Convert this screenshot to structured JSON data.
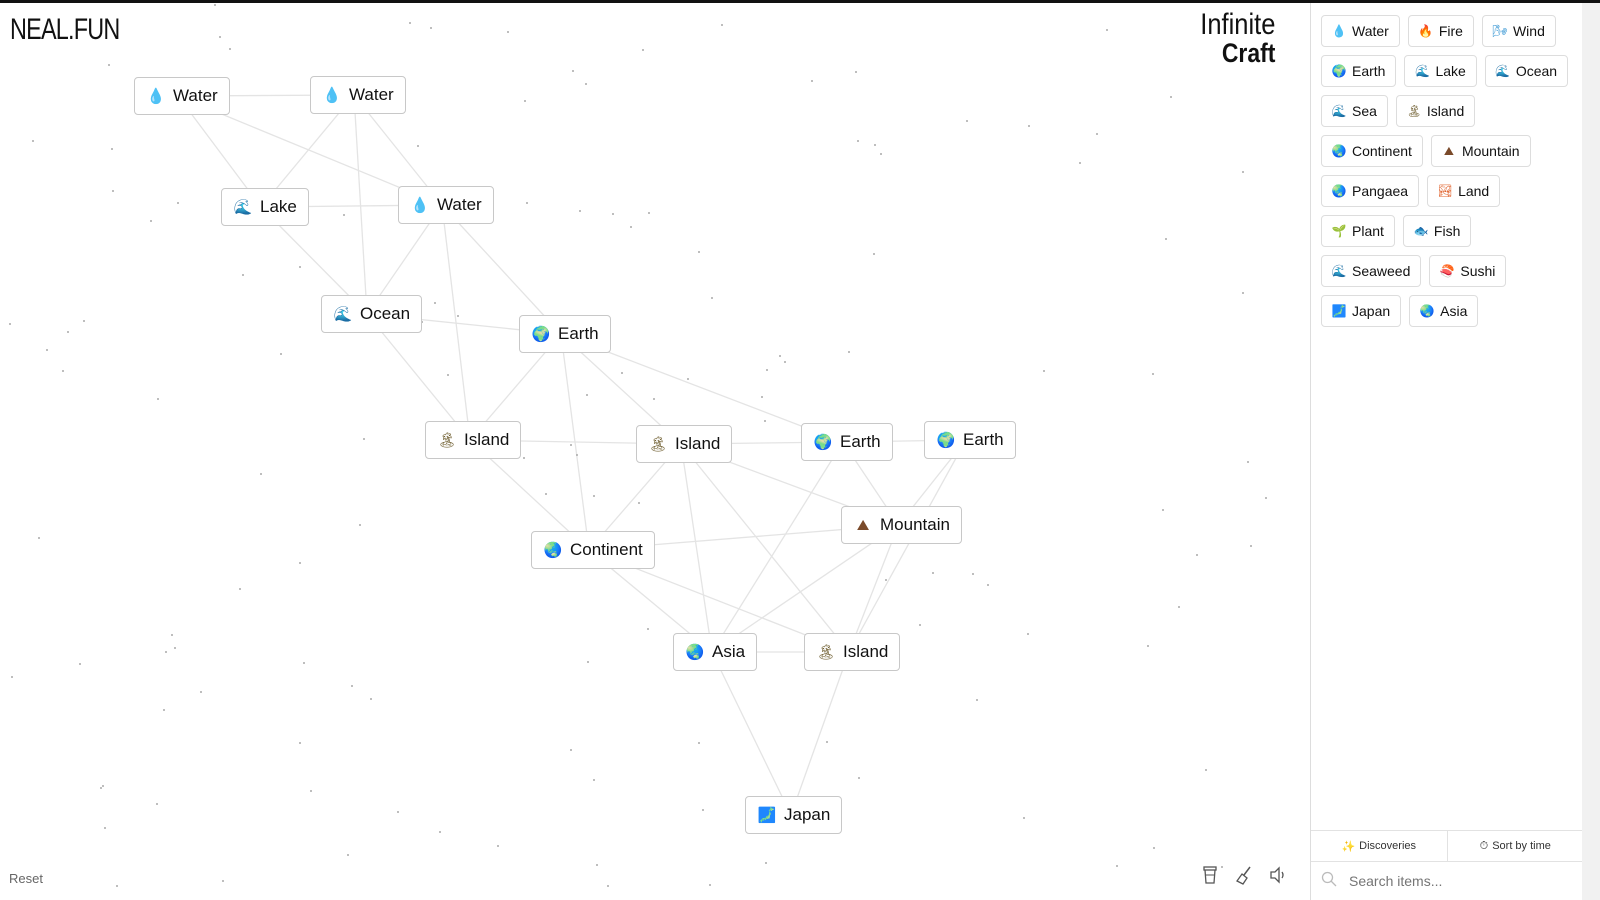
{
  "brand": {
    "logo": "NEAL.FUN",
    "title_line1": "Infinite",
    "title_line2": "Craft"
  },
  "canvas": {
    "nodes": [
      {
        "id": "n1",
        "label": "Water",
        "icon": "water-drop-icon",
        "glyph": "💧",
        "color": "#2aa7e0"
      },
      {
        "id": "n2",
        "label": "Water",
        "icon": "water-drop-icon",
        "glyph": "💧",
        "color": "#2aa7e0"
      },
      {
        "id": "n3",
        "label": "Lake",
        "icon": "wave-icon",
        "glyph": "🌊",
        "color": "#1e9ad6"
      },
      {
        "id": "n4",
        "label": "Water",
        "icon": "water-drop-icon",
        "glyph": "💧",
        "color": "#2aa7e0"
      },
      {
        "id": "n5",
        "label": "Ocean",
        "icon": "wave-icon",
        "glyph": "🌊",
        "color": "#1e9ad6"
      },
      {
        "id": "n6",
        "label": "Earth",
        "icon": "globe-icon",
        "glyph": "🌍",
        "color": "#1f8f6a"
      },
      {
        "id": "n7",
        "label": "Island",
        "icon": "palm-island-icon",
        "glyph": "🏝",
        "color": "#6b5a2a"
      },
      {
        "id": "n8",
        "label": "Island",
        "icon": "palm-island-icon",
        "glyph": "🏝",
        "color": "#6b5a2a"
      },
      {
        "id": "n9",
        "label": "Earth",
        "icon": "globe-icon",
        "glyph": "🌍",
        "color": "#1f8f6a"
      },
      {
        "id": "n10",
        "label": "Earth",
        "icon": "globe-icon",
        "glyph": "🌍",
        "color": "#1f8f6a"
      },
      {
        "id": "n11",
        "label": "Mountain",
        "icon": "mountain-icon",
        "glyph": "⛰",
        "color": "#7a4a2a"
      },
      {
        "id": "n12",
        "label": "Continent",
        "icon": "globe-icon",
        "glyph": "🌏",
        "color": "#1f7fa0"
      },
      {
        "id": "n13",
        "label": "Asia",
        "icon": "globe-icon",
        "glyph": "🌏",
        "color": "#1f7fa0"
      },
      {
        "id": "n14",
        "label": "Island",
        "icon": "palm-island-icon",
        "glyph": "🏝",
        "color": "#6b5a2a"
      },
      {
        "id": "n15",
        "label": "Japan",
        "icon": "japan-map-icon",
        "glyph": "🗾",
        "color": "#2aa060"
      }
    ],
    "reset_label": "Reset"
  },
  "toolbar": {
    "icons": [
      "cup-icon",
      "broom-icon",
      "speaker-icon"
    ]
  },
  "sidebar": {
    "items": [
      {
        "label": "Water",
        "icon": "water-drop-icon",
        "glyph": "💧",
        "color": "#2aa7e0"
      },
      {
        "label": "Fire",
        "icon": "fire-icon",
        "glyph": "🔥",
        "color": "#f08a24"
      },
      {
        "label": "Wind",
        "icon": "wind-icon",
        "glyph": "🌬",
        "color": "#2a8fd0"
      },
      {
        "label": "Earth",
        "icon": "globe-icon",
        "glyph": "🌍",
        "color": "#1f8f6a"
      },
      {
        "label": "Lake",
        "icon": "wave-icon",
        "glyph": "🌊",
        "color": "#1e9ad6"
      },
      {
        "label": "Ocean",
        "icon": "wave-icon",
        "glyph": "🌊",
        "color": "#1e9ad6"
      },
      {
        "label": "Sea",
        "icon": "wave-icon",
        "glyph": "🌊",
        "color": "#1e9ad6"
      },
      {
        "label": "Island",
        "icon": "palm-island-icon",
        "glyph": "🏝",
        "color": "#6b5a2a"
      },
      {
        "label": "Continent",
        "icon": "globe-icon",
        "glyph": "🌏",
        "color": "#1f7fa0"
      },
      {
        "label": "Mountain",
        "icon": "mountain-icon",
        "glyph": "⛰",
        "color": "#7a4a2a"
      },
      {
        "label": "Pangaea",
        "icon": "globe-icon",
        "glyph": "🌏",
        "color": "#1f7fa0"
      },
      {
        "label": "Land",
        "icon": "landscape-icon",
        "glyph": "🏞",
        "color": "#e0602a"
      },
      {
        "label": "Plant",
        "icon": "seedling-icon",
        "glyph": "🌱",
        "color": "#3a9a3a"
      },
      {
        "label": "Fish",
        "icon": "fish-icon",
        "glyph": "🐟",
        "color": "#2a8fd0"
      },
      {
        "label": "Seaweed",
        "icon": "wave-icon",
        "glyph": "🌊",
        "color": "#1e9ad6"
      },
      {
        "label": "Sushi",
        "icon": "sushi-icon",
        "glyph": "🍣",
        "color": "#e0402a"
      },
      {
        "label": "Japan",
        "icon": "japan-map-icon",
        "glyph": "🗾",
        "color": "#2aa060"
      },
      {
        "label": "Asia",
        "icon": "globe-icon",
        "glyph": "🌏",
        "color": "#1f7fa0"
      }
    ],
    "discoveries_label": "Discoveries",
    "sort_label": "Sort by time",
    "search_placeholder": "Search items..."
  }
}
